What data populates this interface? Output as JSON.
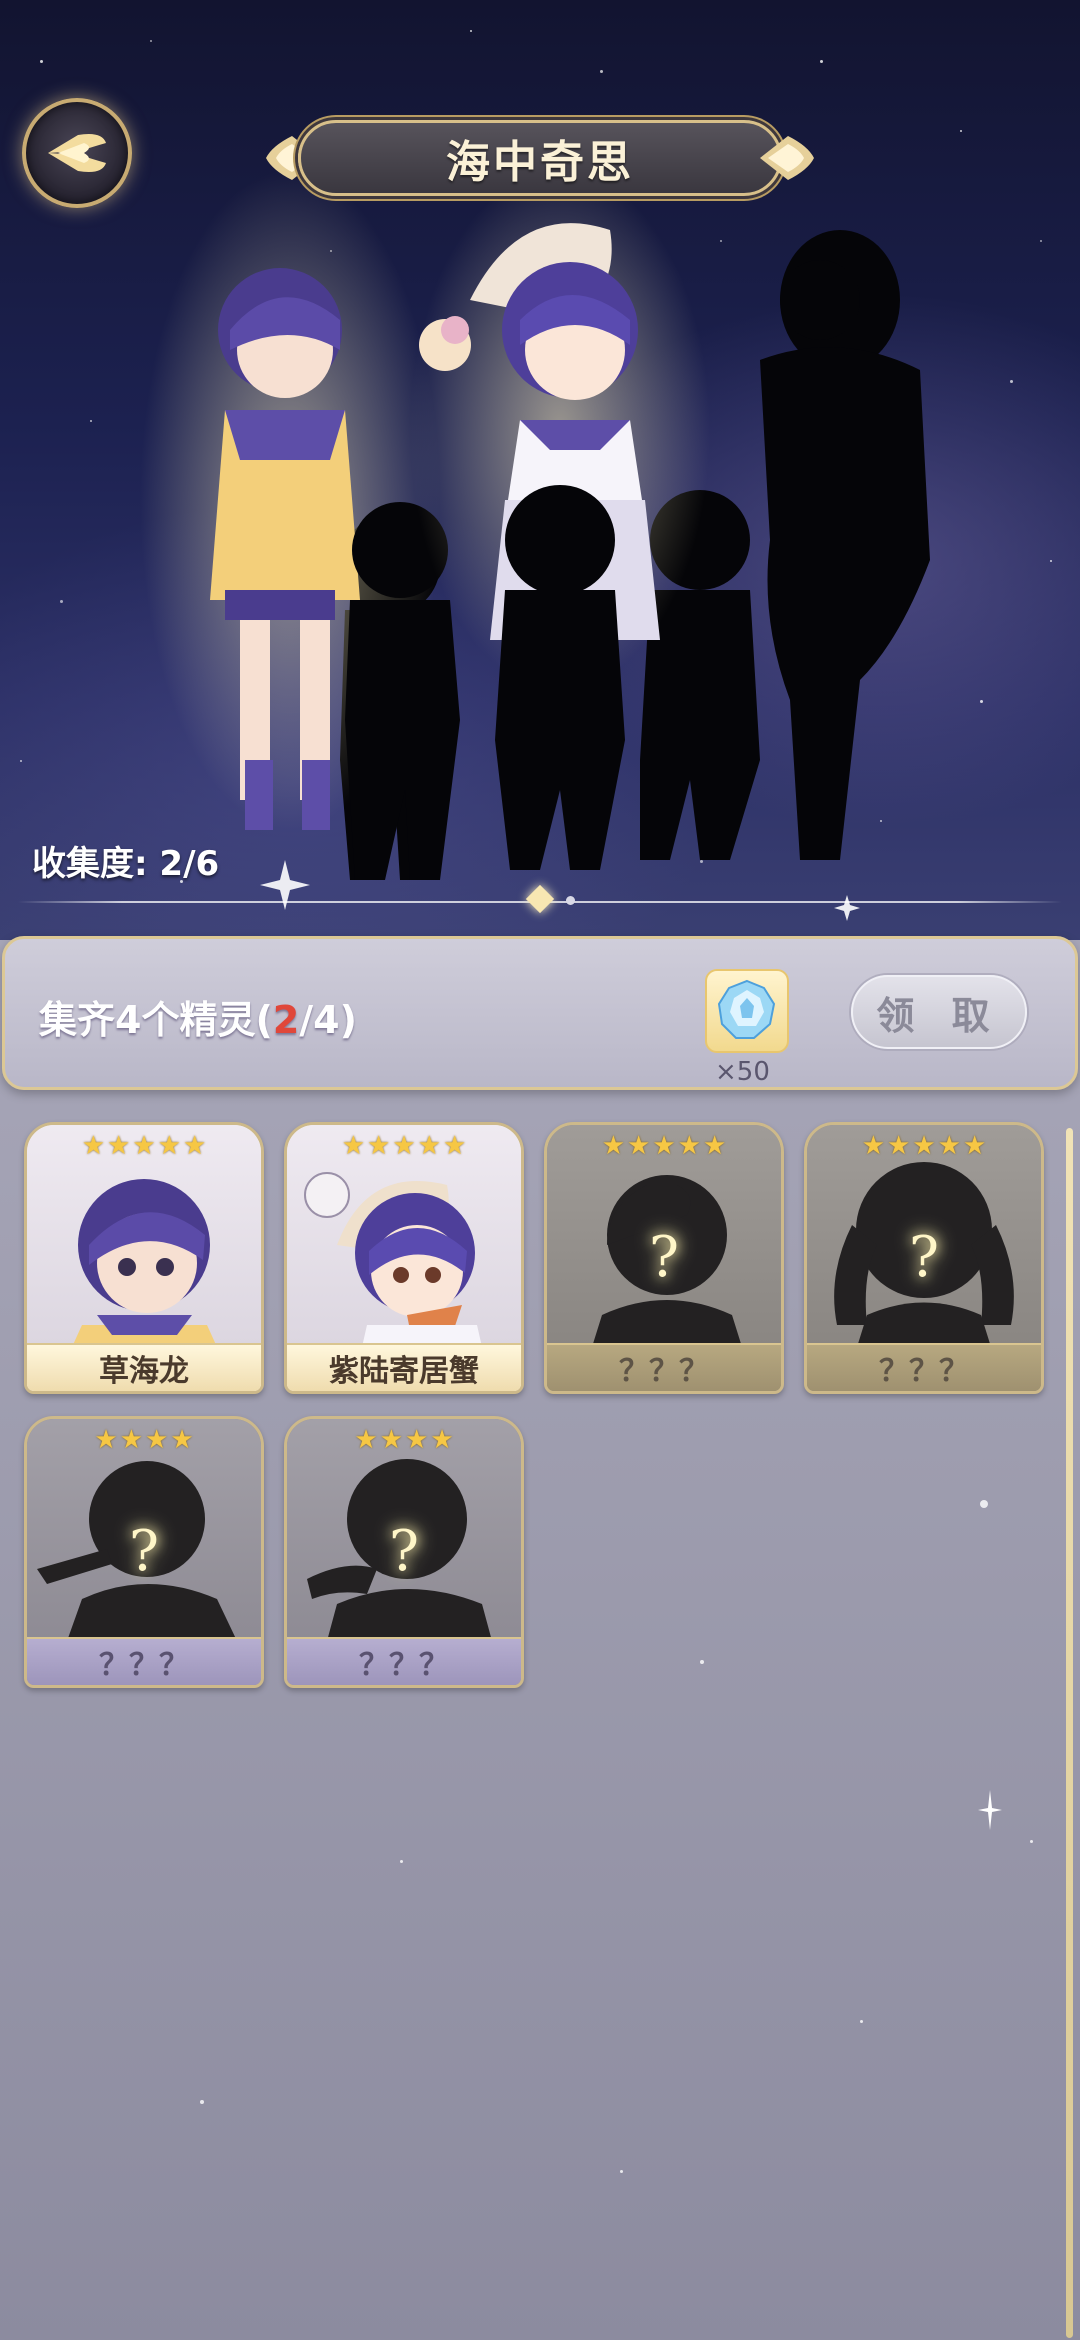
{
  "header": {
    "title": "海中奇思",
    "back_icon": "back-wing-icon"
  },
  "collection": {
    "progress_text": "收集度: 2/6",
    "collected": 2,
    "total": 6
  },
  "pager": {
    "current": 1,
    "pages": 2
  },
  "reward": {
    "text_prefix": "集齐4个精灵(",
    "progress_current": "2",
    "text_suffix": "/4)",
    "item_icon": "blue-crystal-icon",
    "item_count": "×50",
    "claim_label": "领 取"
  },
  "cards": [
    {
      "name": "草海龙",
      "stars": 5,
      "owned": true
    },
    {
      "name": "紫陆寄居蟹",
      "stars": 5,
      "owned": true
    },
    {
      "name": "？？？",
      "stars": 5,
      "owned": false
    },
    {
      "name": "？？？",
      "stars": 5,
      "owned": false
    },
    {
      "name": "？？？",
      "stars": 4,
      "owned": false
    },
    {
      "name": "？？？",
      "stars": 4,
      "owned": false
    }
  ],
  "colors": {
    "accent_gold": "#d8c08a",
    "highlight_red": "#e0473a",
    "star_gold": "#f6c744"
  }
}
